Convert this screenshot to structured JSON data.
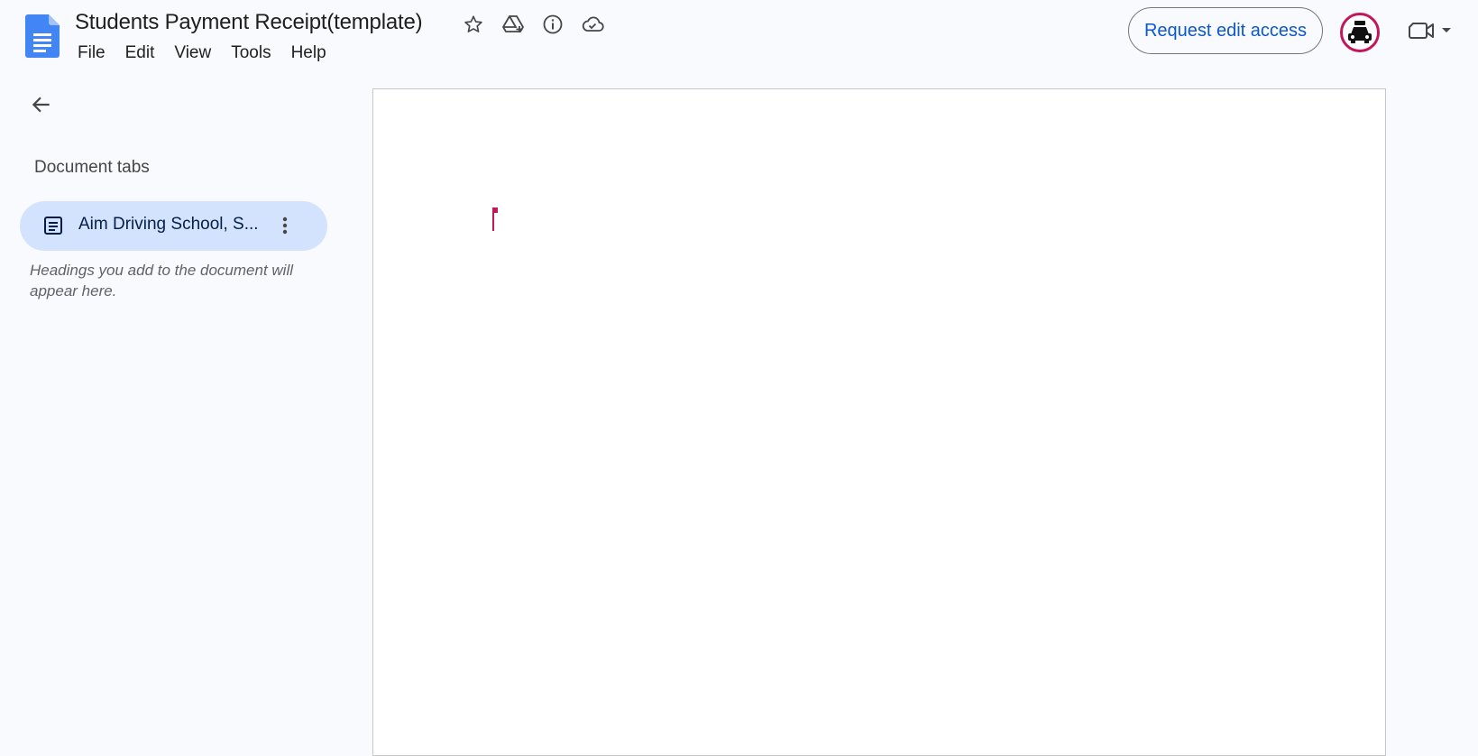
{
  "app": {
    "doc_title": "Students Payment Receipt(template)",
    "menu": [
      "File",
      "Edit",
      "View",
      "Tools",
      "Help"
    ],
    "request_edit_label": "Request edit access"
  },
  "title_icons": [
    "star-icon",
    "move-to-drive-icon",
    "info-icon",
    "cloud-saved-icon"
  ],
  "sidebar": {
    "heading": "Document tabs",
    "tabs": [
      {
        "label": "Aim Driving School, S...",
        "icon": "document-tab-icon"
      }
    ],
    "hint": "Headings you add to the document will appear here."
  },
  "colors": {
    "accent": "#0b57d0",
    "selected_tab": "#d3e3fd",
    "avatar_ring": "#c2185b",
    "cursor": "#c2185b",
    "docs_logo": "#4285f4"
  }
}
